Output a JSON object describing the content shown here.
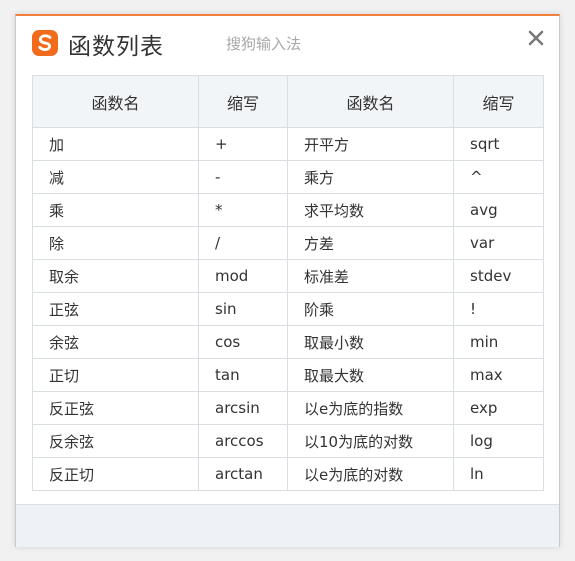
{
  "window": {
    "title": "函数列表",
    "subtitle": "搜狗输入法",
    "accent_color": "#f26b1d",
    "logo_icon": "sogou-logo-icon",
    "close_icon": "close-icon"
  },
  "table": {
    "headers": [
      "函数名",
      "缩写",
      "函数名",
      "缩写"
    ],
    "rows": [
      [
        "加",
        "+",
        "开平方",
        "sqrt"
      ],
      [
        "减",
        "-",
        "乘方",
        "^"
      ],
      [
        "乘",
        "*",
        "求平均数",
        "avg"
      ],
      [
        "除",
        "/",
        "方差",
        "var"
      ],
      [
        "取余",
        "mod",
        "标准差",
        "stdev"
      ],
      [
        "正弦",
        "sin",
        "阶乘",
        "!"
      ],
      [
        "余弦",
        "cos",
        "取最小数",
        "min"
      ],
      [
        "正切",
        "tan",
        "取最大数",
        "max"
      ],
      [
        "反正弦",
        "arcsin",
        "以e为底的指数",
        "exp"
      ],
      [
        "反余弦",
        "arccos",
        "以10为底的对数",
        "log"
      ],
      [
        "反正切",
        "arctan",
        "以e为底的对数",
        "ln"
      ]
    ]
  }
}
